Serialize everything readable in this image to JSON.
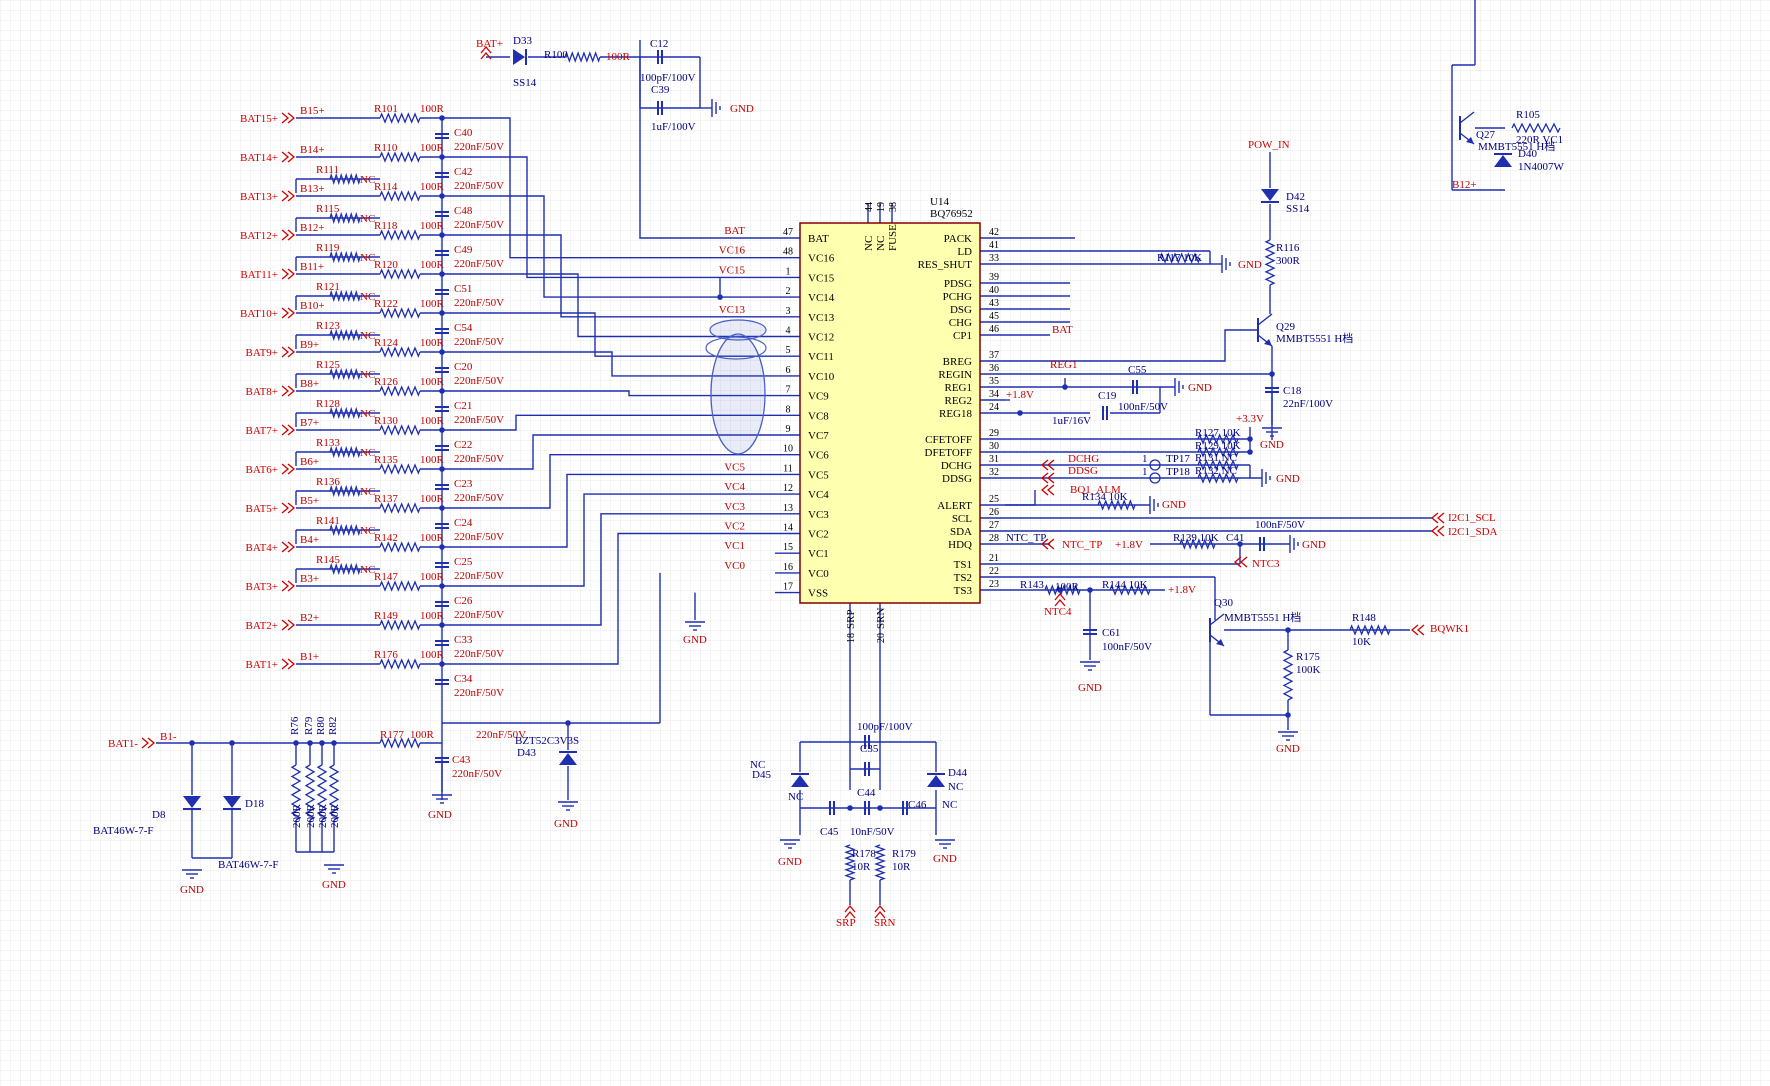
{
  "chip": {
    "ref": "U14",
    "part": "BQ76952",
    "left_pins": [
      {
        "num": "47",
        "name": "BAT",
        "net": "BAT"
      },
      {
        "num": "48",
        "name": "VC16",
        "net": "VC16"
      },
      {
        "num": "1",
        "name": "VC15",
        "net": "VC15"
      },
      {
        "num": "2",
        "name": "VC14",
        "net": ""
      },
      {
        "num": "3",
        "name": "VC13",
        "net": "VC13"
      },
      {
        "num": "4",
        "name": "VC12",
        "net": ""
      },
      {
        "num": "5",
        "name": "VC11",
        "net": ""
      },
      {
        "num": "6",
        "name": "VC10",
        "net": ""
      },
      {
        "num": "7",
        "name": "VC9",
        "net": ""
      },
      {
        "num": "8",
        "name": "VC8",
        "net": ""
      },
      {
        "num": "9",
        "name": "VC7",
        "net": ""
      },
      {
        "num": "10",
        "name": "VC6",
        "net": ""
      },
      {
        "num": "11",
        "name": "VC5",
        "net": "VC5"
      },
      {
        "num": "12",
        "name": "VC4",
        "net": "VC4"
      },
      {
        "num": "13",
        "name": "VC3",
        "net": "VC3"
      },
      {
        "num": "14",
        "name": "VC2",
        "net": "VC2"
      },
      {
        "num": "15",
        "name": "VC1",
        "net": "VC1"
      },
      {
        "num": "16",
        "name": "VC0",
        "net": "VC0"
      },
      {
        "num": "17",
        "name": "VSS",
        "net": ""
      }
    ],
    "right_pins": [
      {
        "num": "42",
        "name": "PACK"
      },
      {
        "num": "41",
        "name": "LD"
      },
      {
        "num": "33",
        "name": "RES_SHUT"
      },
      {
        "num": "39",
        "name": "PDSG"
      },
      {
        "num": "40",
        "name": "PCHG"
      },
      {
        "num": "43",
        "name": "DSG"
      },
      {
        "num": "45",
        "name": "CHG"
      },
      {
        "num": "46",
        "name": "CP1"
      },
      {
        "num": "37",
        "name": "BREG"
      },
      {
        "num": "36",
        "name": "REGIN"
      },
      {
        "num": "35",
        "name": "REG1"
      },
      {
        "num": "34",
        "name": "REG2"
      },
      {
        "num": "24",
        "name": "REG18"
      },
      {
        "num": "29",
        "name": "CFETOFF"
      },
      {
        "num": "30",
        "name": "DFETOFF"
      },
      {
        "num": "31",
        "name": "DCHG"
      },
      {
        "num": "32",
        "name": "DDSG"
      },
      {
        "num": "25",
        "name": "ALERT"
      },
      {
        "num": "26",
        "name": "SCL"
      },
      {
        "num": "27",
        "name": "SDA"
      },
      {
        "num": "28",
        "name": "HDQ"
      },
      {
        "num": "21",
        "name": "TS1"
      },
      {
        "num": "22",
        "name": "TS2"
      },
      {
        "num": "23",
        "name": "TS3"
      }
    ],
    "top_pins": [
      {
        "num": "44",
        "name": "NC"
      },
      {
        "num": "19",
        "name": "NC"
      },
      {
        "num": "38",
        "name": "FUSE"
      }
    ],
    "bottom_pins": [
      {
        "num": "18",
        "name": "SRP"
      },
      {
        "num": "20",
        "name": "SRN"
      }
    ]
  },
  "batteries": [
    {
      "port": "BAT15+",
      "net": "B15+",
      "r": "R101",
      "rv": "100R",
      "rn": "",
      "c": "C40",
      "cv": "220nF/50V"
    },
    {
      "port": "BAT14+",
      "net": "B14+",
      "r": "R110",
      "rv": "100R",
      "rn": "R111",
      "c": "C42",
      "cv": "220nF/50V"
    },
    {
      "port": "BAT13+",
      "net": "B13+",
      "r": "R114",
      "rv": "100R",
      "rn": "R115",
      "c": "C48",
      "cv": "220nF/50V"
    },
    {
      "port": "BAT12+",
      "net": "B12+",
      "r": "R118",
      "rv": "100R",
      "rn": "R119",
      "c": "C49",
      "cv": "220nF/50V"
    },
    {
      "port": "BAT11+",
      "net": "B11+",
      "r": "R120",
      "rv": "100R",
      "rn": "R121",
      "c": "C51",
      "cv": "220nF/50V"
    },
    {
      "port": "BAT10+",
      "net": "B10+",
      "r": "R122",
      "rv": "100R",
      "rn": "R123",
      "c": "C54",
      "cv": "220nF/50V"
    },
    {
      "port": "BAT9+",
      "net": "B9+",
      "r": "R124",
      "rv": "100R",
      "rn": "R125",
      "c": "C20",
      "cv": "220nF/50V"
    },
    {
      "port": "BAT8+",
      "net": "B8+",
      "r": "R126",
      "rv": "100R",
      "rn": "R128",
      "c": "C21",
      "cv": "220nF/50V"
    },
    {
      "port": "BAT7+",
      "net": "B7+",
      "r": "R130",
      "rv": "100R",
      "rn": "R133",
      "c": "C22",
      "cv": "220nF/50V"
    },
    {
      "port": "BAT6+",
      "net": "B6+",
      "r": "R135",
      "rv": "100R",
      "rn": "R136",
      "c": "C23",
      "cv": "220nF/50V"
    },
    {
      "port": "BAT5+",
      "net": "B5+",
      "r": "R137",
      "rv": "100R",
      "rn": "R141",
      "c": "C24",
      "cv": "220nF/50V"
    },
    {
      "port": "BAT4+",
      "net": "B4+",
      "r": "R142",
      "rv": "100R",
      "rn": "R145",
      "c": "C25",
      "cv": "220nF/50V"
    },
    {
      "port": "BAT3+",
      "net": "B3+",
      "r": "R147",
      "rv": "100R",
      "rn": "",
      "c": "C26",
      "cv": "220nF/50V"
    },
    {
      "port": "BAT2+",
      "net": "B2+",
      "r": "R149",
      "rv": "100R",
      "rn": "",
      "c": "C33",
      "cv": "220nF/50V"
    },
    {
      "port": "BAT1+",
      "net": "B1+",
      "r": "R176",
      "rv": "100R",
      "rn": "",
      "c": "C34",
      "cv": "220nF/50V"
    }
  ],
  "text": {
    "nc": "NC",
    "gnd": "GND",
    "bat_plus": "BAT+",
    "d33": "D33",
    "ss14": "SS14",
    "r100": "R100",
    "r100v": "100R",
    "c12": "C12",
    "c12v": "100pF/100V",
    "c39": "C39",
    "c39v": "1uF/100V",
    "bat1m": "BAT1-",
    "b1m": "B1-",
    "r177": "R177",
    "r177v": "100R",
    "c43": "C43",
    "c43v": "220nF/50V",
    "c34v": "220nF/50V",
    "bzt": "BZT52C3V3S",
    "d43": "D43",
    "d8": "D8",
    "d18": "D18",
    "bat46a": "BAT46W-7-F",
    "bat46b": "BAT46W-7-F",
    "r76": "R76",
    "r79": "R79",
    "r80": "R80",
    "r82": "R82",
    "r200": "200R",
    "pow_in": "POW_IN",
    "d42": "D42",
    "r116": "R116",
    "r116v": "300R",
    "q29": "Q29",
    "q29v": "MMBT5551 H档",
    "c18": "C18",
    "c18v": "22nF/100V",
    "r117": "R117 10K",
    "reg1": "REG1",
    "c55": "C55",
    "c55v": "100nF/50V",
    "v18": "+1.8V",
    "c19": "C19",
    "c19v": "1uF/16V",
    "v33": "+3.3V",
    "r127": "R127 10K",
    "r129": "R129 10K",
    "r131": "R131 NC",
    "r132": "R132 NC",
    "dchg": "DCHG",
    "ddsg": "DDSG",
    "tp17": "TP17",
    "tp18": "TP18",
    "one": "1",
    "bq1alm": "BQ1_ALM",
    "r134": "R134 10K",
    "i2c_scl": "I2C1_SCL",
    "i2c_sda": "I2C1_SDA",
    "ntc_tp": "NTC_TP",
    "c41": "C41",
    "c41v": "100nF/50V",
    "r139": "R139 10K",
    "ntc3": "NTC3",
    "ntc4": "NTC4",
    "r143": "R143",
    "r143v": "100R",
    "r144": "R144 10K",
    "c61": "C61",
    "c61v": "100nF/50V",
    "q30": "Q30",
    "q30v": "MMBT5551 H档",
    "r148": "R148",
    "r148v": "10K",
    "bqwk1": "BQWK1",
    "r175": "R175",
    "r175v": "100K",
    "c35": "C35",
    "c35v": "100pF/100V",
    "c44": "C44",
    "c44v": "10nF/50V",
    "c45": "C45",
    "c46": "C46",
    "d44": "D44",
    "d45": "D45",
    "r178": "R178",
    "r179": "R179",
    "r10": "10R",
    "srp": "SRP",
    "srn": "SRN",
    "r105": "R105",
    "r105v": "220R VC1",
    "q27": "Q27",
    "q27v": "MMBT5551 H档",
    "d40": "D40",
    "d40v": "1N4007W",
    "b12p": "B12+",
    "r200k": "200R",
    "ld_bat": "BAT"
  },
  "colors": {
    "wire": "#1f2fb0",
    "label": "#000080",
    "port": "#d00000",
    "chip_fill": "#ffffb0",
    "chip_stroke": "#800000",
    "grid": "#e6e6e6",
    "highlight": "#4a5fc8"
  }
}
